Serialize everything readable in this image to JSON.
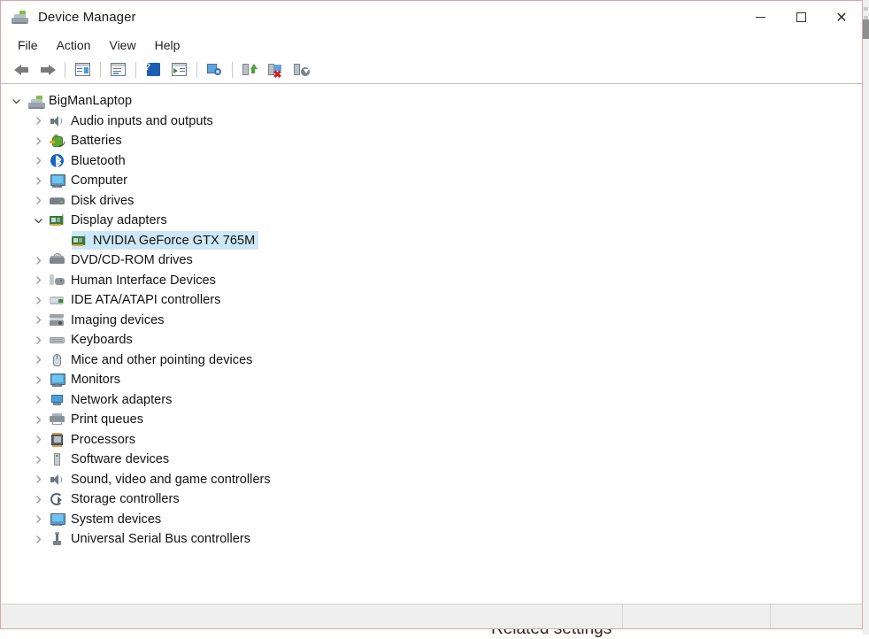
{
  "background": {
    "cut_off_text": "Related settings"
  },
  "window": {
    "title": "Device Manager",
    "title_icon": "device-manager-icon",
    "controls": {
      "minimize": "─",
      "maximize": "□",
      "close": "✕"
    }
  },
  "menubar": {
    "items": [
      {
        "label": "File"
      },
      {
        "label": "Action"
      },
      {
        "label": "View"
      },
      {
        "label": "Help"
      }
    ]
  },
  "toolbar": {
    "buttons": [
      {
        "name": "back-arrow-icon"
      },
      {
        "name": "forward-arrow-icon"
      },
      {
        "name": "show-hide-console-tree-icon"
      },
      {
        "name": "properties-icon"
      },
      {
        "name": "help-icon"
      },
      {
        "name": "update-driver-icon"
      },
      {
        "name": "scan-for-hardware-changes-icon"
      },
      {
        "name": "update-driver-software-icon"
      },
      {
        "name": "uninstall-device-icon"
      },
      {
        "name": "disable-device-icon"
      }
    ]
  },
  "tree": {
    "root": {
      "label": "BigManLaptop",
      "icon": "computer-icon",
      "expanded": true,
      "level": 0
    },
    "nodes": [
      {
        "label": "Audio inputs and outputs",
        "icon": "speaker-icon",
        "expanded": false,
        "level": 1,
        "selected": false
      },
      {
        "label": "Batteries",
        "icon": "battery-icon",
        "expanded": false,
        "level": 1,
        "selected": false
      },
      {
        "label": "Bluetooth",
        "icon": "bluetooth-icon",
        "expanded": false,
        "level": 1,
        "selected": false
      },
      {
        "label": "Computer",
        "icon": "monitor-icon",
        "expanded": false,
        "level": 1,
        "selected": false
      },
      {
        "label": "Disk drives",
        "icon": "disk-drive-icon",
        "expanded": false,
        "level": 1,
        "selected": false
      },
      {
        "label": "Display adapters",
        "icon": "display-adapter-icon",
        "expanded": true,
        "level": 1,
        "selected": false
      },
      {
        "label": "NVIDIA GeForce GTX 765M",
        "icon": "display-adapter-icon",
        "expanded": null,
        "level": 2,
        "selected": true
      },
      {
        "label": "DVD/CD-ROM drives",
        "icon": "dvd-drive-icon",
        "expanded": false,
        "level": 1,
        "selected": false
      },
      {
        "label": "Human Interface Devices",
        "icon": "hid-icon",
        "expanded": false,
        "level": 1,
        "selected": false
      },
      {
        "label": "IDE ATA/ATAPI controllers",
        "icon": "ide-controller-icon",
        "expanded": false,
        "level": 1,
        "selected": false
      },
      {
        "label": "Imaging devices",
        "icon": "imaging-device-icon",
        "expanded": false,
        "level": 1,
        "selected": false
      },
      {
        "label": "Keyboards",
        "icon": "keyboard-icon",
        "expanded": false,
        "level": 1,
        "selected": false
      },
      {
        "label": "Mice and other pointing devices",
        "icon": "mouse-icon",
        "expanded": false,
        "level": 1,
        "selected": false
      },
      {
        "label": "Monitors",
        "icon": "monitor-icon",
        "expanded": false,
        "level": 1,
        "selected": false
      },
      {
        "label": "Network adapters",
        "icon": "network-adapter-icon",
        "expanded": false,
        "level": 1,
        "selected": false
      },
      {
        "label": "Print queues",
        "icon": "printer-icon",
        "expanded": false,
        "level": 1,
        "selected": false
      },
      {
        "label": "Processors",
        "icon": "processor-icon",
        "expanded": false,
        "level": 1,
        "selected": false
      },
      {
        "label": "Software devices",
        "icon": "software-device-icon",
        "expanded": false,
        "level": 1,
        "selected": false
      },
      {
        "label": "Sound, video and game controllers",
        "icon": "speaker-icon",
        "expanded": false,
        "level": 1,
        "selected": false
      },
      {
        "label": "Storage controllers",
        "icon": "storage-controller-icon",
        "expanded": false,
        "level": 1,
        "selected": false
      },
      {
        "label": "System devices",
        "icon": "monitor-icon",
        "expanded": false,
        "level": 1,
        "selected": false
      },
      {
        "label": "Universal Serial Bus controllers",
        "icon": "usb-icon",
        "expanded": false,
        "level": 1,
        "selected": false
      }
    ]
  },
  "statusbar": {
    "panel1": "",
    "panel2": "",
    "panel3": ""
  },
  "colors": {
    "selection": "#cce8f7",
    "window_border": "#d9a7a7",
    "toolbar_rule": "#bfbfbf",
    "statusbar_bg": "#efefef"
  }
}
